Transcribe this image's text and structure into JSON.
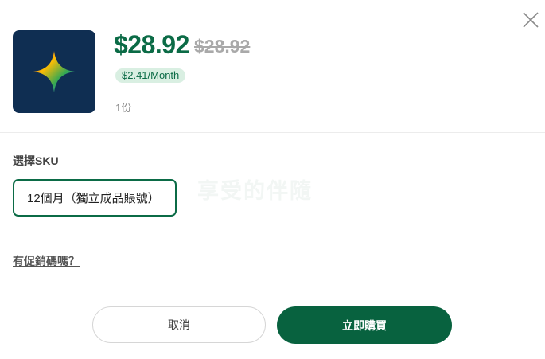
{
  "dialog": {
    "close_icon": "close-icon",
    "product_icon": "sparkle-icon"
  },
  "pricing": {
    "current": "$28.92",
    "original": "$28.92",
    "monthly": "$2.41/Month",
    "quantity": "1份"
  },
  "sku": {
    "label": "選擇SKU",
    "selected_option": "12個月（獨立成品賬號）"
  },
  "watermark": "享受的伴隨",
  "promo": {
    "link_text": "有促銷碼嗎？"
  },
  "actions": {
    "cancel_label": "取消",
    "buy_label": "立即購買"
  },
  "colors": {
    "brand_green": "#0b6b46",
    "thumbnail_bg": "#0f2e52"
  }
}
